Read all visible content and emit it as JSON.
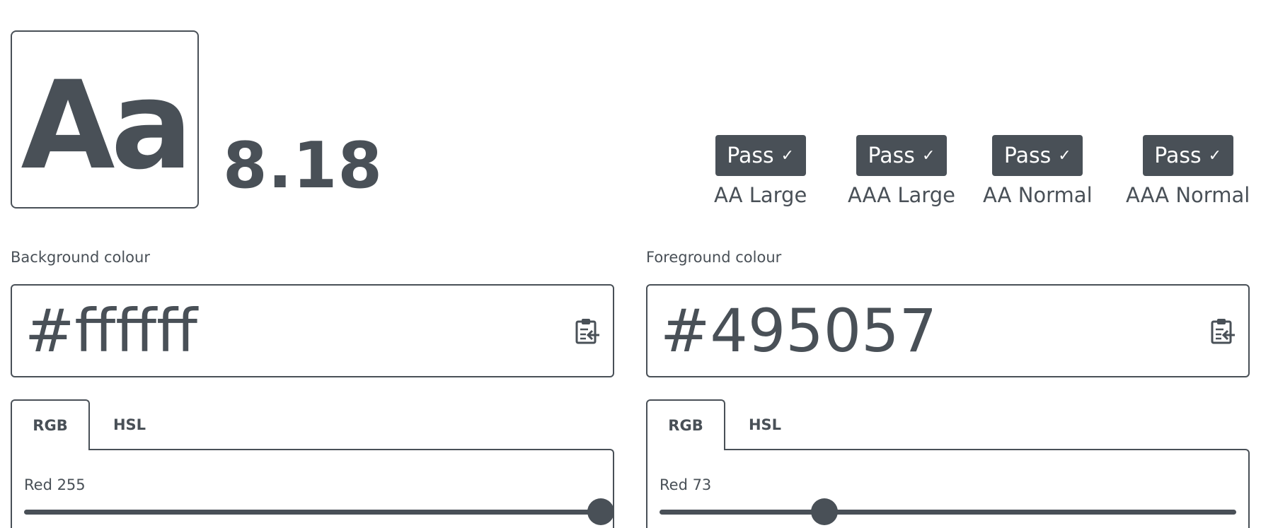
{
  "preview": {
    "sample": "Aa"
  },
  "contrast_ratio": "8.18",
  "results": [
    {
      "status": "Pass",
      "check": "✓",
      "label": "AA Large"
    },
    {
      "status": "Pass",
      "check": "✓",
      "label": "AAA Large"
    },
    {
      "status": "Pass",
      "check": "✓",
      "label": "AA Normal"
    },
    {
      "status": "Pass",
      "check": "✓",
      "label": "AAA Normal"
    }
  ],
  "background": {
    "label": "Background colour",
    "value": "#ffffff",
    "tabs": [
      "RGB",
      "HSL"
    ],
    "active_tab": "RGB",
    "slider": {
      "label": "Red 255",
      "value": 255,
      "max": 255
    }
  },
  "foreground": {
    "label": "Foreground colour",
    "value": "#495057",
    "tabs": [
      "RGB",
      "HSL"
    ],
    "active_tab": "RGB",
    "slider": {
      "label": "Red 73",
      "value": 73,
      "max": 255
    }
  },
  "colors": {
    "text": "#495057",
    "page": "#ffffff"
  },
  "icons": {
    "paste": "clipboard-paste-icon",
    "check": "checkmark"
  }
}
